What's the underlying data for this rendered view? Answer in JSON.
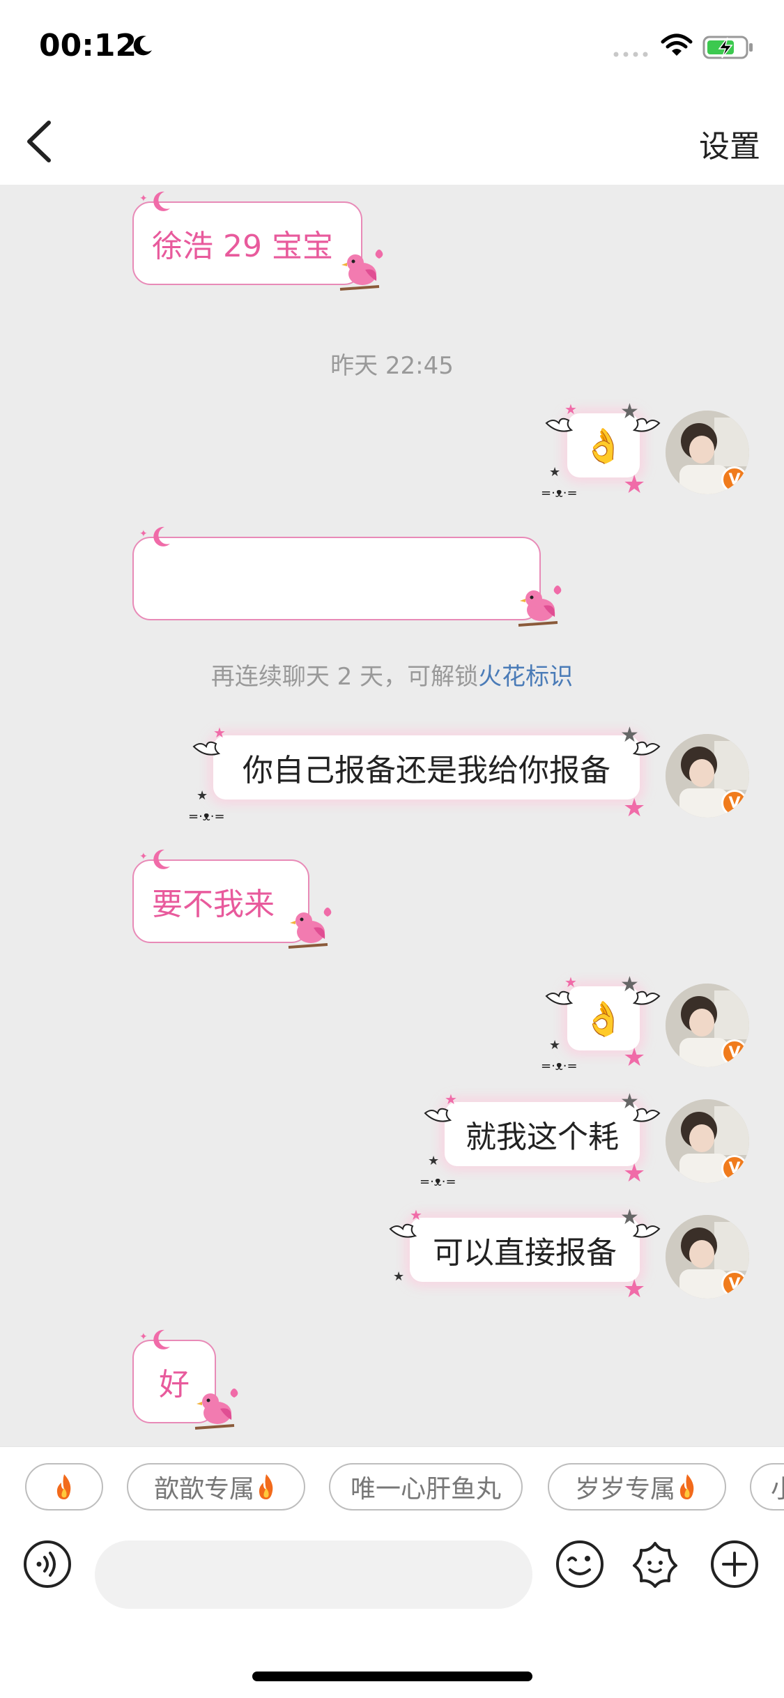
{
  "status_bar": {
    "time": "00:12"
  },
  "nav": {
    "settings_label": "设置"
  },
  "messages": {
    "m1": "徐浩 29 宝宝",
    "timestamp": "昨天 22:45",
    "m2_emoji": "👌",
    "m3": "",
    "system_prefix": "再连续聊天 2 天，可解锁",
    "system_link": "火花标识",
    "m4": "你自己报备还是我给你报备",
    "m5": "要不我来",
    "m6_emoji": "👌",
    "m7": "就我这个耗",
    "m8": "可以直接报备",
    "m9": "好"
  },
  "face_text": "=·ᴥ·=",
  "quick_replies": [
    {
      "label": "",
      "has_flame": true
    },
    {
      "label": "歆歆专属",
      "has_flame": true
    },
    {
      "label": "唯一心肝鱼丸",
      "has_flame": false
    },
    {
      "label": "岁岁专属",
      "has_flame": true
    },
    {
      "label": "小",
      "has_flame": false
    }
  ],
  "input": {
    "placeholder": ""
  },
  "colors": {
    "pink_text": "#e85a9c",
    "link_blue": "#4a7bb7",
    "badge_orange": "#f07b1c"
  }
}
